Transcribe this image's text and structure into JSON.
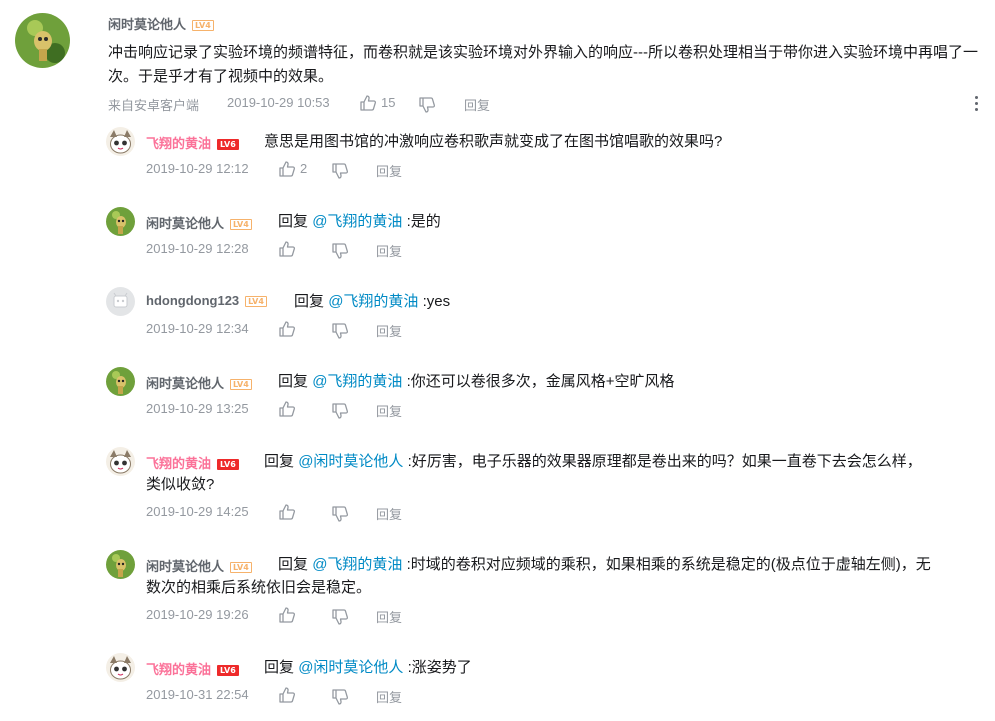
{
  "main_comment": {
    "username": "闲时莫论他人",
    "level": "LV4",
    "text": "冲击响应记录了实验环境的频谱特征，而卷积就是该实验环境对外界输入的响应---所以卷积处理相当于带你进入实验环境中再唱了一次。于是乎才有了视频中的效果。",
    "source": "来自安卓客户端",
    "time": "2019-10-29 10:53",
    "likes": "15",
    "reply_label": "回复"
  },
  "replies": [
    {
      "username": "飞翔的黄油",
      "level": "LV6",
      "prefix": "",
      "mention": "",
      "text": "意思是用图书馆的冲激响应卷积歌声就变成了在图书馆唱歌的效果吗?",
      "time": "2019-10-29 12:12",
      "likes": "2",
      "reply_label": "回复"
    },
    {
      "username": "闲时莫论他人",
      "level": "LV4",
      "prefix": "回复",
      "mention": "@飞翔的黄油",
      "text": ":是的",
      "time": "2019-10-29 12:28",
      "likes": "",
      "reply_label": "回复"
    },
    {
      "username": "hdongdong123",
      "level": "LV4",
      "prefix": "回复",
      "mention": "@飞翔的黄油",
      "text": ":yes",
      "time": "2019-10-29 12:34",
      "likes": "",
      "reply_label": "回复"
    },
    {
      "username": "闲时莫论他人",
      "level": "LV4",
      "prefix": "回复",
      "mention": "@飞翔的黄油",
      "text": ":你还可以卷很多次，金属风格+空旷风格",
      "time": "2019-10-29 13:25",
      "likes": "",
      "reply_label": "回复"
    },
    {
      "username": "飞翔的黄油",
      "level": "LV6",
      "prefix": "回复",
      "mention": "@闲时莫论他人",
      "text": ":好厉害，电子乐器的效果器原理都是卷出来的吗？如果一直卷下去会怎么样，",
      "text2": "类似收敛?",
      "time": "2019-10-29 14:25",
      "likes": "",
      "reply_label": "回复"
    },
    {
      "username": "闲时莫论他人",
      "level": "LV4",
      "prefix": "回复",
      "mention": "@飞翔的黄油",
      "text": ":时域的卷积对应频域的乘积，如果相乘的系统是稳定的(极点位于虚轴左侧)，无",
      "text2": "数次的相乘后系统依旧会是稳定。",
      "time": "2019-10-29 19:26",
      "likes": "",
      "reply_label": "回复"
    },
    {
      "username": "飞翔的黄油",
      "level": "LV6",
      "prefix": "回复",
      "mention": "@闲时莫论他人",
      "text": ":涨姿势了",
      "time": "2019-10-31 22:54",
      "likes": "",
      "reply_label": "回复"
    }
  ],
  "icons": {
    "like": "thumbs-up-icon",
    "dislike": "thumbs-down-icon",
    "more": "more-vertical-icon"
  }
}
